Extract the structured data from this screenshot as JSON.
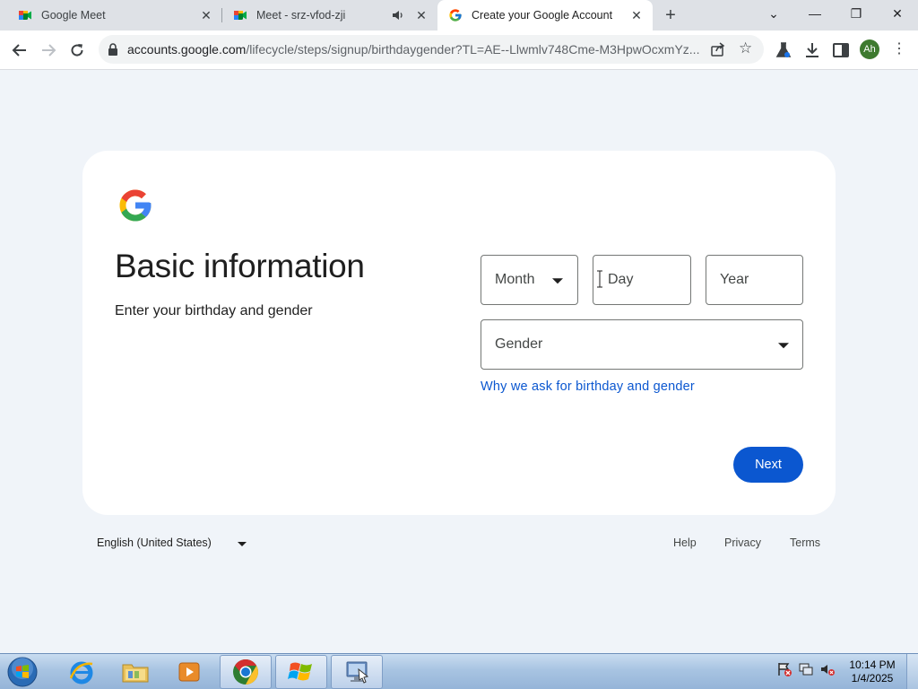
{
  "browser": {
    "tabs": [
      {
        "title": "Google Meet",
        "icon": "google-meet-icon"
      },
      {
        "title": "Meet - srz-vfod-zji",
        "icon": "google-meet-icon",
        "audio": "speaker-icon"
      },
      {
        "title": "Create your Google Account",
        "icon": "google-g-icon",
        "active": true
      }
    ],
    "url_host": "accounts.google.com",
    "url_path": "/lifecycle/steps/signup/birthdaygender?TL=AE--Llwmlv748Cme-M3HpwOcxmYz...",
    "avatar_initials": "Ah"
  },
  "page": {
    "heading": "Basic information",
    "subheading": "Enter your birthday and gender",
    "month_placeholder": "Month",
    "day_placeholder": "Day",
    "year_placeholder": "Year",
    "gender_placeholder": "Gender",
    "why_link": "Why we ask for birthday and gender",
    "next_label": "Next"
  },
  "footer": {
    "language": "English (United States)",
    "help": "Help",
    "privacy": "Privacy",
    "terms": "Terms"
  },
  "taskbar": {
    "time": "10:14 PM",
    "date": "1/4/2025"
  },
  "colors": {
    "page_bg": "#f0f4f9",
    "accent": "#0b57d0",
    "tabstrip": "#dee1e6"
  }
}
